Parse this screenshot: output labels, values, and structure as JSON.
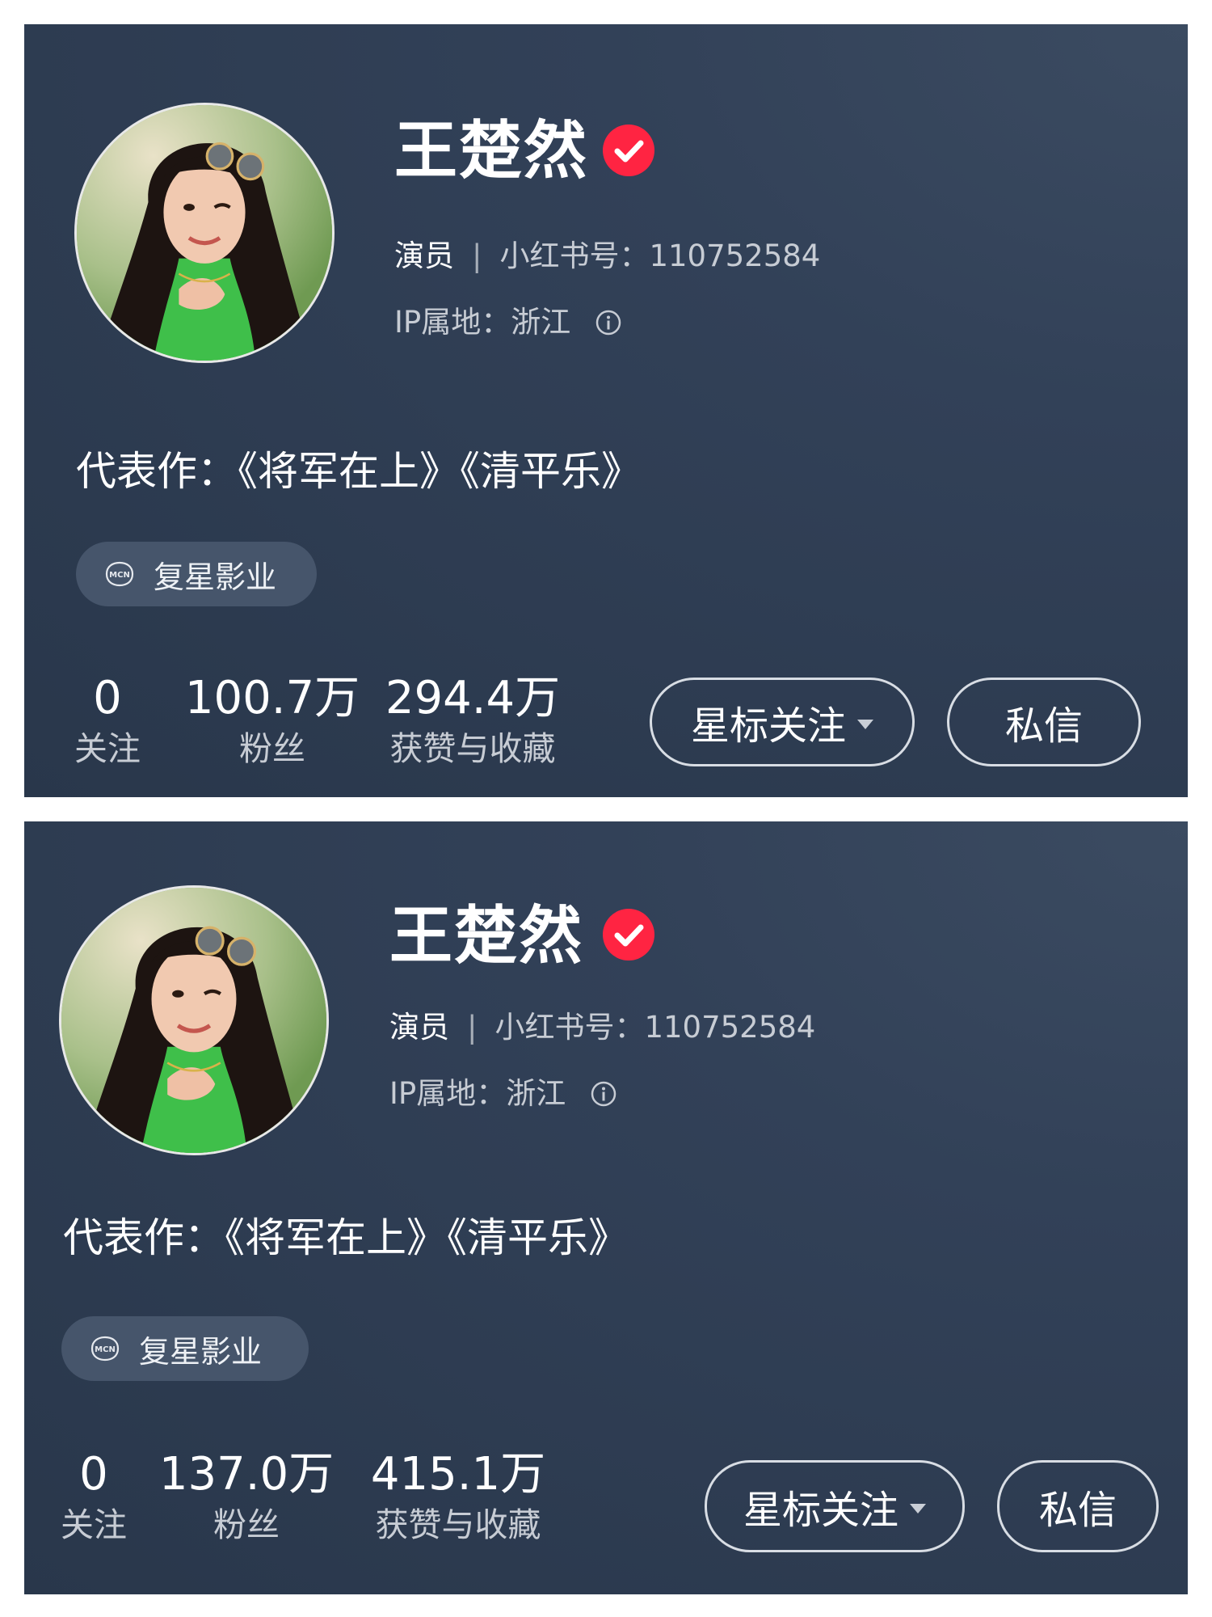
{
  "cards": [
    {
      "name": "王楚然",
      "role": "演员",
      "separator": "|",
      "xhs_id_label": "小红书号：",
      "xhs_id": "110752584",
      "ip_label": "IP属地：",
      "ip_location": "浙江",
      "works": "代表作：《将军在上》《清平乐》",
      "mcn_icon_text": "MCN",
      "mcn": "复星影业",
      "stats": {
        "following": {
          "value": "0",
          "label": "关注"
        },
        "followers": {
          "value": "100.7万",
          "label": "粉丝"
        },
        "likes": {
          "value": "294.4万",
          "label": "获赞与收藏"
        }
      },
      "star_follow_button": "星标关注",
      "message_button": "私信"
    },
    {
      "name": "王楚然",
      "role": "演员",
      "separator": "|",
      "xhs_id_label": "小红书号：",
      "xhs_id": "110752584",
      "ip_label": "IP属地：",
      "ip_location": "浙江",
      "works": "代表作：《将军在上》《清平乐》",
      "mcn_icon_text": "MCN",
      "mcn": "复星影业",
      "stats": {
        "following": {
          "value": "0",
          "label": "关注"
        },
        "followers": {
          "value": "137.0万",
          "label": "粉丝"
        },
        "likes": {
          "value": "415.1万",
          "label": "获赞与收藏"
        }
      },
      "star_follow_button": "星标关注",
      "message_button": "私信"
    }
  ],
  "icons": {
    "verified": "verified-check-icon",
    "info": "info-circle-icon",
    "mcn": "mcn-badge-icon",
    "dropdown": "caret-down-icon"
  },
  "colors": {
    "card_bg": "#2f3d52",
    "verified_red": "#ff2442",
    "text_primary": "#ffffff",
    "text_secondary": "#c7ccd4",
    "chip_bg": "#46556b"
  }
}
